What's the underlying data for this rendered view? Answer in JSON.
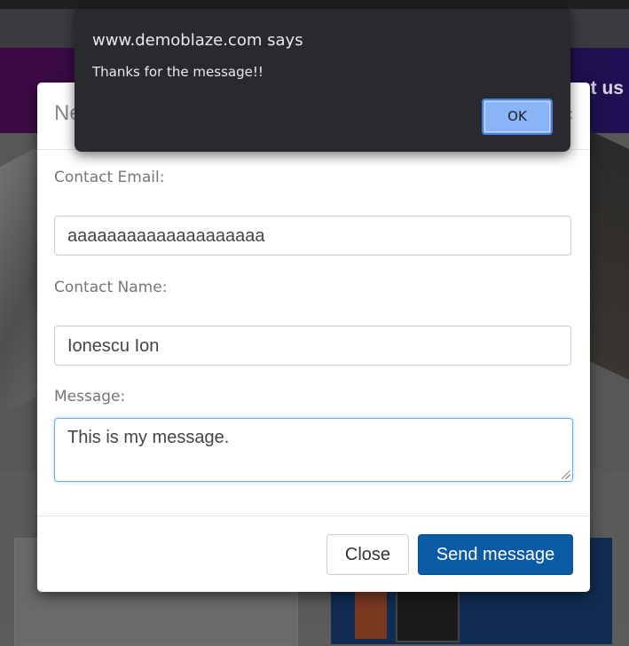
{
  "background": {
    "banner_text": "ut us"
  },
  "modal": {
    "title": "Ne",
    "close_x": "×",
    "email_label": "Contact Email:",
    "email_value": "aaaaaaaaaaaaaaaaaaaa",
    "name_label": "Contact Name:",
    "name_value": "Ionescu Ion",
    "message_label": "Message:",
    "message_value": "This is my message.",
    "close_button": "Close",
    "send_button": "Send message"
  },
  "alert": {
    "origin": "www.demoblaze.com says",
    "message": "Thanks for the message!!",
    "ok_button": "OK"
  },
  "colors": {
    "primary_button": "#0b5aa6",
    "alert_background": "#292a2d",
    "alert_ok": "#8ab4f8"
  }
}
